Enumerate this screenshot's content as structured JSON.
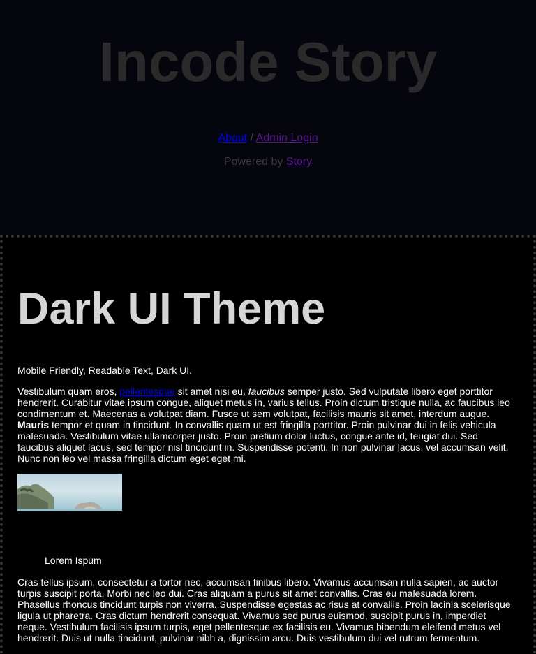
{
  "header": {
    "site_title": "Incode Story",
    "nav": {
      "about_label": "About",
      "separator": " / ",
      "admin_label": "Admin Login"
    },
    "powered": {
      "prefix": "Powered by ",
      "link_label": "Story"
    }
  },
  "post": {
    "title": "Dark UI Theme",
    "tagline": "Mobile Friendly, Readable Text, Dark UI.",
    "para1": {
      "part1": "Vestibulum quam eros, ",
      "link": "pellentesque",
      "part2": " sit amet nisi eu, ",
      "italic": "faucibus",
      "part3": " semper justo. Sed vulputate libero eget porttitor hendrerit. Curabitur vitae ipsum congue, aliquet metus in, varius tellus. Proin dictum tristique nulla, ac faucibus leo condimentum et. Maecenas a volutpat diam. Fusce ut sem volutpat, facilisis mauris sit amet, interdum augue. ",
      "bold": "Mauris",
      "part4": " tempor et quam in tincidunt. In convallis quam ut est fringilla porttitor. Proin pulvinar dui in felis vehicula malesuada. Vestibulum vitae ullamcorper justo. Proin pretium dolor luctus, congue ante id, feugiat dui. Sed faucibus aliquet lacus, sed tempor nisl tincidunt in. Suspendisse potenti. In non pulvinar lacus, vel accumsan velit. Nunc non leo vel massa fringilla dictum eget eget mi."
    },
    "image_caption": "Lorem Ispum",
    "para2": "Cras tellus ipsum, consectetur a tortor nec, accumsan finibus libero. Vivamus accumsan nulla sapien, ac auctor turpis suscipit porta. Morbi nec leo dui. Cras aliquam a purus sit amet convallis. Cras eu malesuada lorem. Phasellus rhoncus tincidunt turpis non viverra. Suspendisse egestas ac risus at convallis. Proin lacinia scelerisque ligula ut pharetra. Cras dictum hendrerit consequat. Vivamus sed purus euismod, suscipit purus in, imperdiet neque. Vestibulum facilisis ipsum turpis, eget pellentesque ex facilisis eu. Vivamus bibendum eleifend metus vel hendrerit. Duis ut nulla tincidunt, pulvinar nibh a, dignissim arcu. Duis vestibulum dui vel rutrum fermentum."
  },
  "colors": {
    "header_bg": "#05050e",
    "page_bg": "#000000",
    "title_color": "#2a2a2a",
    "post_title_color": "#d6d6d6",
    "link_unvisited": "#0000ee",
    "link_visited": "#551a8b"
  }
}
